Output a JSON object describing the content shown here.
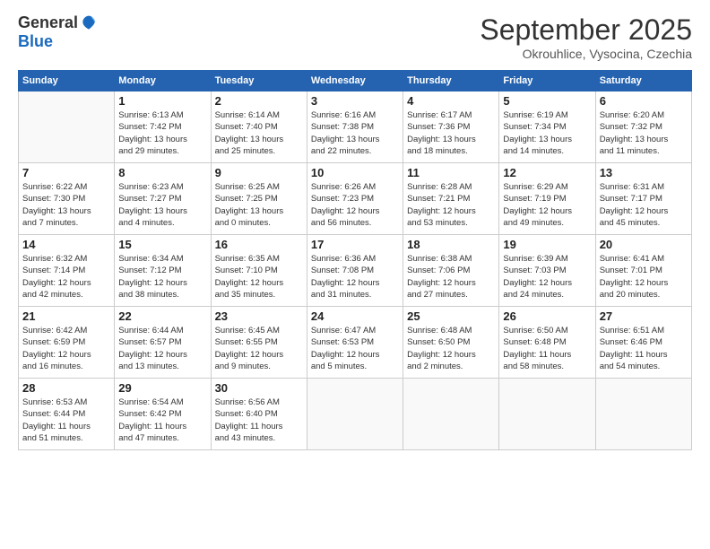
{
  "logo": {
    "general": "General",
    "blue": "Blue"
  },
  "header": {
    "month": "September 2025",
    "location": "Okrouhlice, Vysocina, Czechia"
  },
  "days_of_week": [
    "Sunday",
    "Monday",
    "Tuesday",
    "Wednesday",
    "Thursday",
    "Friday",
    "Saturday"
  ],
  "weeks": [
    [
      {
        "day": "",
        "info": ""
      },
      {
        "day": "1",
        "info": "Sunrise: 6:13 AM\nSunset: 7:42 PM\nDaylight: 13 hours\nand 29 minutes."
      },
      {
        "day": "2",
        "info": "Sunrise: 6:14 AM\nSunset: 7:40 PM\nDaylight: 13 hours\nand 25 minutes."
      },
      {
        "day": "3",
        "info": "Sunrise: 6:16 AM\nSunset: 7:38 PM\nDaylight: 13 hours\nand 22 minutes."
      },
      {
        "day": "4",
        "info": "Sunrise: 6:17 AM\nSunset: 7:36 PM\nDaylight: 13 hours\nand 18 minutes."
      },
      {
        "day": "5",
        "info": "Sunrise: 6:19 AM\nSunset: 7:34 PM\nDaylight: 13 hours\nand 14 minutes."
      },
      {
        "day": "6",
        "info": "Sunrise: 6:20 AM\nSunset: 7:32 PM\nDaylight: 13 hours\nand 11 minutes."
      }
    ],
    [
      {
        "day": "7",
        "info": "Sunrise: 6:22 AM\nSunset: 7:30 PM\nDaylight: 13 hours\nand 7 minutes."
      },
      {
        "day": "8",
        "info": "Sunrise: 6:23 AM\nSunset: 7:27 PM\nDaylight: 13 hours\nand 4 minutes."
      },
      {
        "day": "9",
        "info": "Sunrise: 6:25 AM\nSunset: 7:25 PM\nDaylight: 13 hours\nand 0 minutes."
      },
      {
        "day": "10",
        "info": "Sunrise: 6:26 AM\nSunset: 7:23 PM\nDaylight: 12 hours\nand 56 minutes."
      },
      {
        "day": "11",
        "info": "Sunrise: 6:28 AM\nSunset: 7:21 PM\nDaylight: 12 hours\nand 53 minutes."
      },
      {
        "day": "12",
        "info": "Sunrise: 6:29 AM\nSunset: 7:19 PM\nDaylight: 12 hours\nand 49 minutes."
      },
      {
        "day": "13",
        "info": "Sunrise: 6:31 AM\nSunset: 7:17 PM\nDaylight: 12 hours\nand 45 minutes."
      }
    ],
    [
      {
        "day": "14",
        "info": "Sunrise: 6:32 AM\nSunset: 7:14 PM\nDaylight: 12 hours\nand 42 minutes."
      },
      {
        "day": "15",
        "info": "Sunrise: 6:34 AM\nSunset: 7:12 PM\nDaylight: 12 hours\nand 38 minutes."
      },
      {
        "day": "16",
        "info": "Sunrise: 6:35 AM\nSunset: 7:10 PM\nDaylight: 12 hours\nand 35 minutes."
      },
      {
        "day": "17",
        "info": "Sunrise: 6:36 AM\nSunset: 7:08 PM\nDaylight: 12 hours\nand 31 minutes."
      },
      {
        "day": "18",
        "info": "Sunrise: 6:38 AM\nSunset: 7:06 PM\nDaylight: 12 hours\nand 27 minutes."
      },
      {
        "day": "19",
        "info": "Sunrise: 6:39 AM\nSunset: 7:03 PM\nDaylight: 12 hours\nand 24 minutes."
      },
      {
        "day": "20",
        "info": "Sunrise: 6:41 AM\nSunset: 7:01 PM\nDaylight: 12 hours\nand 20 minutes."
      }
    ],
    [
      {
        "day": "21",
        "info": "Sunrise: 6:42 AM\nSunset: 6:59 PM\nDaylight: 12 hours\nand 16 minutes."
      },
      {
        "day": "22",
        "info": "Sunrise: 6:44 AM\nSunset: 6:57 PM\nDaylight: 12 hours\nand 13 minutes."
      },
      {
        "day": "23",
        "info": "Sunrise: 6:45 AM\nSunset: 6:55 PM\nDaylight: 12 hours\nand 9 minutes."
      },
      {
        "day": "24",
        "info": "Sunrise: 6:47 AM\nSunset: 6:53 PM\nDaylight: 12 hours\nand 5 minutes."
      },
      {
        "day": "25",
        "info": "Sunrise: 6:48 AM\nSunset: 6:50 PM\nDaylight: 12 hours\nand 2 minutes."
      },
      {
        "day": "26",
        "info": "Sunrise: 6:50 AM\nSunset: 6:48 PM\nDaylight: 11 hours\nand 58 minutes."
      },
      {
        "day": "27",
        "info": "Sunrise: 6:51 AM\nSunset: 6:46 PM\nDaylight: 11 hours\nand 54 minutes."
      }
    ],
    [
      {
        "day": "28",
        "info": "Sunrise: 6:53 AM\nSunset: 6:44 PM\nDaylight: 11 hours\nand 51 minutes."
      },
      {
        "day": "29",
        "info": "Sunrise: 6:54 AM\nSunset: 6:42 PM\nDaylight: 11 hours\nand 47 minutes."
      },
      {
        "day": "30",
        "info": "Sunrise: 6:56 AM\nSunset: 6:40 PM\nDaylight: 11 hours\nand 43 minutes."
      },
      {
        "day": "",
        "info": ""
      },
      {
        "day": "",
        "info": ""
      },
      {
        "day": "",
        "info": ""
      },
      {
        "day": "",
        "info": ""
      }
    ]
  ]
}
